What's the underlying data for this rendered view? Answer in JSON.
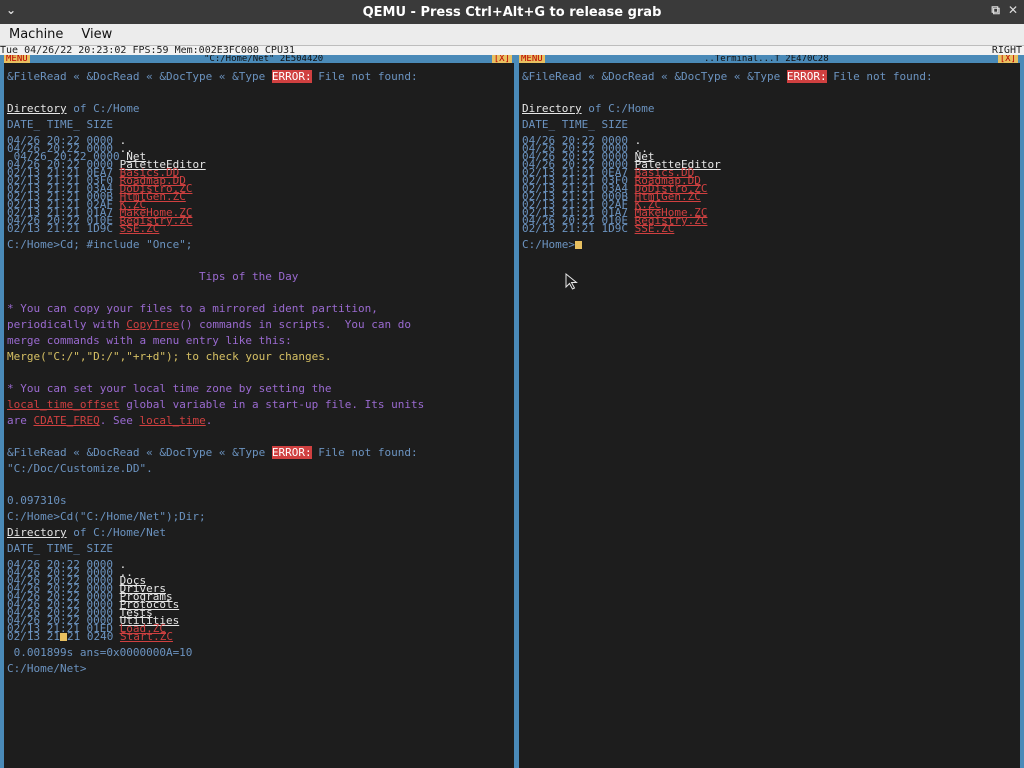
{
  "window": {
    "title": "QEMU - Press Ctrl+Alt+G to release grab",
    "menu": [
      "Machine",
      "View"
    ]
  },
  "status_line": {
    "text": "Tue 04/26/22 20:23:02 FPS:59 Mem:002E3FC000 CPU31",
    "right": "RIGHT"
  },
  "left_pane": {
    "menu_label": "MENU",
    "title": "\"C:/Home/Net\" 2E504420",
    "close_label": "[X]",
    "header_1": "&FileRead « &DocRead « &DocType « &Type ",
    "error_label": "ERROR:",
    "header_1b": " File not found:",
    "dir1_heading": "Directory",
    "dir1_of": " of C:/Home",
    "columns": "DATE_ TIME_ SIZE",
    "dir1": [
      {
        "meta": "04/26 20:22 0000 ",
        "name": "."
      },
      {
        "meta": "04/26 20:22 0000 ",
        "name": ".."
      },
      {
        "meta": " 04/26 20:22 0000 ",
        "name": "Net"
      },
      {
        "meta": "04/26 20:22 0000 ",
        "name": "PaletteEditor"
      },
      {
        "meta": "02/13 21:21 0EA7 ",
        "name": "Basics.DD"
      },
      {
        "meta": "02/13 21:21 03F0 ",
        "name": "Roadmap.DD"
      },
      {
        "meta": "02/13 21:21 03A4 ",
        "name": "DoDistro.ZC"
      },
      {
        "meta": "02/13 21:21 000B ",
        "name": "HtmlGen.ZC"
      },
      {
        "meta": "02/13 21:21 02AF ",
        "name": "K.ZC"
      },
      {
        "meta": "02/13 21:21 01A7 ",
        "name": "MakeHome.ZC"
      },
      {
        "meta": "04/26 20:22 010E ",
        "name": "Registry.ZC"
      },
      {
        "meta": "02/13 21:21 1D9C ",
        "name": "SSE.ZC"
      }
    ],
    "cmd1": "C:/Home>Cd; #include \"Once\";",
    "tips_title": "Tips of the Day",
    "tip1_a": "* You can copy your files to a mirrored ident partition,",
    "tip1_b1": "periodically with ",
    "tip1_b_link": "CopyTree",
    "tip1_b2": "() commands in scripts.  You can do",
    "tip1_c": "merge commands with a menu entry like this:",
    "tip1_d": "Merge(\"C:/\",\"D:/\",\"+r+d\"); to check your changes.",
    "tip2_a": "* You can set your local time zone by setting the",
    "tip2_b_link": "local_time_offset",
    "tip2_b2": " global variable in a start-up file. Its units",
    "tip2_c1": "are ",
    "tip2_c_link": "CDATE_FREQ",
    "tip2_c2": ". See ",
    "tip2_c_link2": "local_time",
    "tip2_c3": ".",
    "header_2": "&FileRead « &DocRead « &DocType « &Type ",
    "header_2b": " File not found:",
    "header_2c": "\"C:/Doc/Customize.DD\".",
    "timing1": "0.097310s",
    "cmd2": "C:/Home>Cd(\"C:/Home/Net\");Dir;",
    "dir2_heading": "Directory",
    "dir2_of": " of C:/Home/Net",
    "dir2": [
      {
        "meta": "04/26 20:22 0000 ",
        "name": "."
      },
      {
        "meta": "04/26 20:22 0000 ",
        "name": ".."
      },
      {
        "meta": "04/26 20:22 0000 ",
        "name": "Docs"
      },
      {
        "meta": "04/26 20:22 0000 ",
        "name": "Drivers"
      },
      {
        "meta": "04/26 20:22 0000 ",
        "name": "Programs"
      },
      {
        "meta": "04/26 20:22 0000 ",
        "name": "Protocols"
      },
      {
        "meta": "04/26 20:22 0000 ",
        "name": "Tests"
      },
      {
        "meta": "04/26 20:22 0000 ",
        "name": "Utilities"
      },
      {
        "meta": "02/13 21:21 01ED ",
        "name": "Load.ZC"
      },
      {
        "meta": "02/13 21",
        "meta_b": "21 0240 ",
        "name": "Start.ZC"
      }
    ],
    "timing2": " 0.001899s ans=0x0000000A=10",
    "prompt": "C:/Home/Net>"
  },
  "right_pane": {
    "menu_label": "MENU",
    "title": "..Terminal...T 2E470C28",
    "close_label": "[X]",
    "header_1": "&FileRead « &DocRead « &DocType « &Type ",
    "error_label": "ERROR:",
    "header_1b": " File not found:",
    "dir_heading": "Directory",
    "dir_of": " of C:/Home",
    "columns": "DATE_ TIME_ SIZE",
    "dir": [
      {
        "meta": "04/26 20:22 0000 ",
        "name": "."
      },
      {
        "meta": "04/26 20:22 0000 ",
        "name": ".."
      },
      {
        "meta": "04/26 20:22 0000 ",
        "name": "Net"
      },
      {
        "meta": "04/26 20:22 0000 ",
        "name": "PaletteEditor"
      },
      {
        "meta": "02/13 21:21 0EA7 ",
        "name": "Basics.DD"
      },
      {
        "meta": "02/13 21:21 03F0 ",
        "name": "Roadmap.DD"
      },
      {
        "meta": "02/13 21:21 03A4 ",
        "name": "DoDistro.ZC"
      },
      {
        "meta": "02/13 21:21 000B ",
        "name": "HtmlGen.ZC"
      },
      {
        "meta": "02/13 21:21 02AF ",
        "name": "K.ZC"
      },
      {
        "meta": "02/13 21:21 01A7 ",
        "name": "MakeHome.ZC"
      },
      {
        "meta": "04/26 20:22 010E ",
        "name": "Registry.ZC"
      },
      {
        "meta": "02/13 21:21 1D9C ",
        "name": "SSE.ZC"
      }
    ],
    "prompt": "C:/Home>"
  },
  "colors": {
    "border": "#4a8ab8",
    "text": "#6b93c0",
    "link": "#d04040",
    "accent": "#e8c060"
  }
}
